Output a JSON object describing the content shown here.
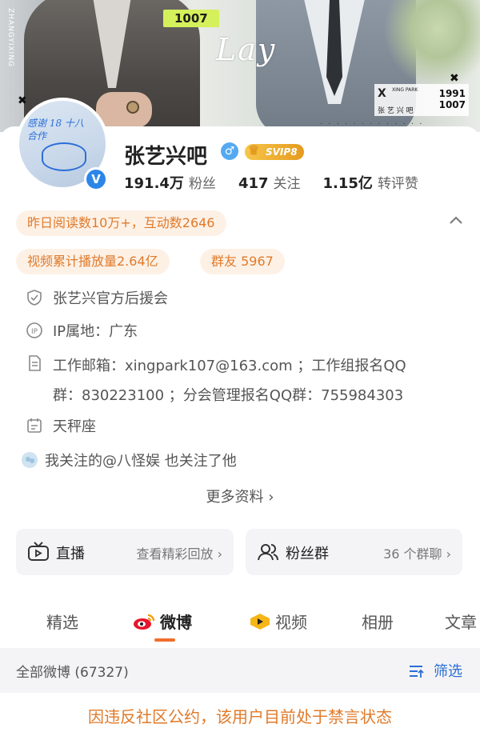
{
  "banner": {
    "tag": "1007",
    "script_text": "Lay",
    "vertical_text": "ZHANGYIXING",
    "logo_mark": "X",
    "logo_sub": "XING PARK",
    "logo_zh": "张 艺 兴 吧",
    "years_top": "1991",
    "years_bottom": "1007"
  },
  "profile": {
    "name": "张艺兴吧",
    "svip": "SVIP8",
    "verified_mark": "V",
    "avatar_scribble": "感谢 18 十八\n合作"
  },
  "stats": [
    {
      "num": "191.4万",
      "label": "粉丝"
    },
    {
      "num": "417",
      "label": "关注"
    },
    {
      "num": "1.15亿",
      "label": "转评赞"
    }
  ],
  "pills": {
    "read": "昨日阅读数10万+，互动数2646",
    "video": "视频累计播放量2.64亿",
    "group": "群友 5967"
  },
  "info": {
    "org": "张艺兴官方后援会",
    "ip": "IP属地：广东",
    "email_line1": "工作邮箱：xingpark107@163.com  ；工作组报名QQ",
    "email_line2": "群：830223100  ；分会管理报名QQ群：755984303",
    "zodiac": "天秤座",
    "follow_note": "我关注的@八怪娱  也关注了他",
    "more": "更多资料 ›"
  },
  "boxes": {
    "live_title": "直播",
    "live_action": "查看精彩回放 ›",
    "fans_title": "粉丝群",
    "fans_action": "36 个群聊 ›"
  },
  "tabs": [
    "精选",
    "微博",
    "视频",
    "相册",
    "文章"
  ],
  "filter": {
    "left": "全部微博 (67327)",
    "right": "筛选"
  },
  "banned": "因违反社区公约，该用户目前处于禁言状态",
  "colors": {
    "accent": "#e07a2a",
    "link": "#2a6ed5",
    "verified": "#2b86e8"
  }
}
